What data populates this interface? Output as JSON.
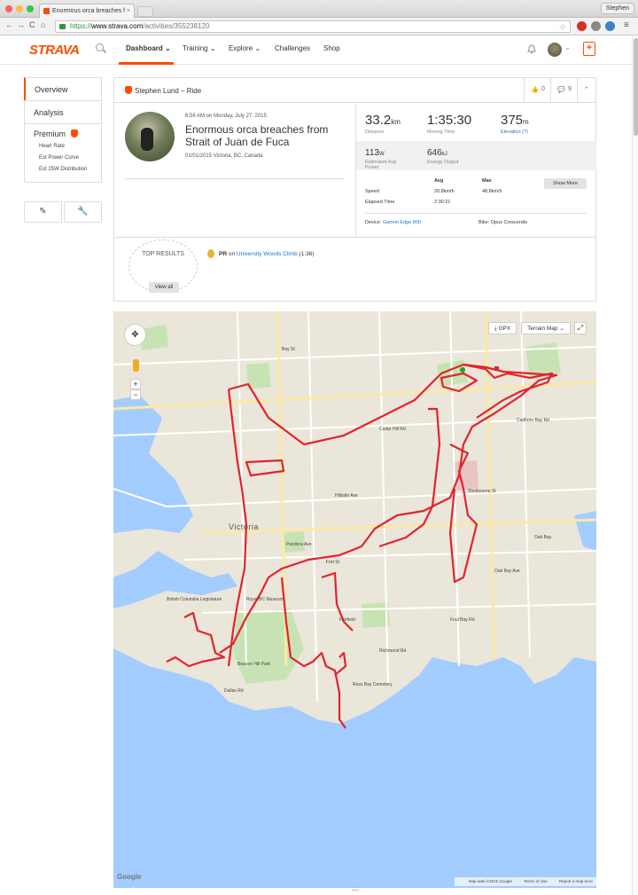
{
  "browser": {
    "tab_title": "Enormous orca breaches f",
    "tab_close": "×",
    "user_name": "Stephen",
    "url_scheme": "https://",
    "url_host": "www.strava.com",
    "url_path": "/activities/355238120",
    "back": "←",
    "forward": "→",
    "reload": "C",
    "home": "⌂",
    "star": "☆",
    "menu": "≡"
  },
  "header": {
    "logo": "STRAVA",
    "nav": [
      {
        "label": "Dashboard ⌄"
      },
      {
        "label": "Training ⌄"
      },
      {
        "label": "Explore ⌄"
      },
      {
        "label": "Challenges"
      },
      {
        "label": "Shop"
      }
    ],
    "upload": "+"
  },
  "sidebar": {
    "items": [
      "Overview",
      "Analysis"
    ],
    "premium_label": "Premium",
    "premium_items": [
      "Heart Rate",
      "Est Power Curve",
      "Est 25W Distribution"
    ],
    "tools": [
      "✎",
      "🔧"
    ]
  },
  "activity": {
    "header_title": "Stephen Lund – Ride",
    "kudos_count": "0",
    "comments_count": "9",
    "collapse": "⌃",
    "time": "6:56 AM on Monday, July 27, 2015",
    "name": "Enormous orca breaches from Strait of Juan de Fuca",
    "location": "01/01/2015 Victoria, BC, Canada",
    "stats": [
      {
        "value": "33.2",
        "unit": "km",
        "label": "Distance"
      },
      {
        "value": "1:35:30",
        "unit": "",
        "label": "Moving Time"
      },
      {
        "value": "375",
        "unit": "m",
        "label": "Elevation (?)"
      }
    ],
    "secondary": [
      {
        "value": "113",
        "unit": "W",
        "label": "Estimated Avg Power"
      },
      {
        "value": "646",
        "unit": "kJ",
        "label": "Energy Output"
      }
    ],
    "table": {
      "headers": [
        "Avg",
        "Max"
      ],
      "rows": [
        {
          "label": "Speed",
          "avg": "20.8km/h",
          "max": "48.8km/h"
        },
        {
          "label": "Elapsed Time",
          "avg": "2:30:21",
          "max": ""
        }
      ]
    },
    "show_more": "Show More",
    "device_label": "Device:",
    "device": "Garmin Edge 800",
    "bike_label": "Bike:",
    "bike": "Opus Crescendo",
    "top_results_label": "TOP RESULTS",
    "view_all": "View all",
    "pr_prefix": "PR",
    "pr_on": "on",
    "pr_segment": "University Woods Climb",
    "pr_time": "(1:36)"
  },
  "map": {
    "gpx_label": "⤓ GPX",
    "terrain_label": "Terrain Map ⌄",
    "fullscreen": "⤢",
    "pan": "✥",
    "zoom_in": "+",
    "zoom_out": "−",
    "city_label": "Victoria",
    "labels": [
      "Oak Bay",
      "British Columbia Legislature",
      "Royal BC Museum",
      "Fairfield",
      "Dallas Rd",
      "Fort St",
      "Pandora Ave",
      "Bay St",
      "Richmond Rd",
      "Foul Bay Rd",
      "Cedar Hill Rd",
      "Shelbourne St",
      "Hillside Ave",
      "Oak Bay Ave",
      "Cadboro Bay Rd",
      "Ross Bay Cemetery",
      "Beacon Hill Park"
    ],
    "google": "Google",
    "footer_data": "Map data ©2015 Google",
    "footer_terms": "Terms of Use",
    "footer_report": "Report a map error",
    "route_color": "#e3232b"
  }
}
